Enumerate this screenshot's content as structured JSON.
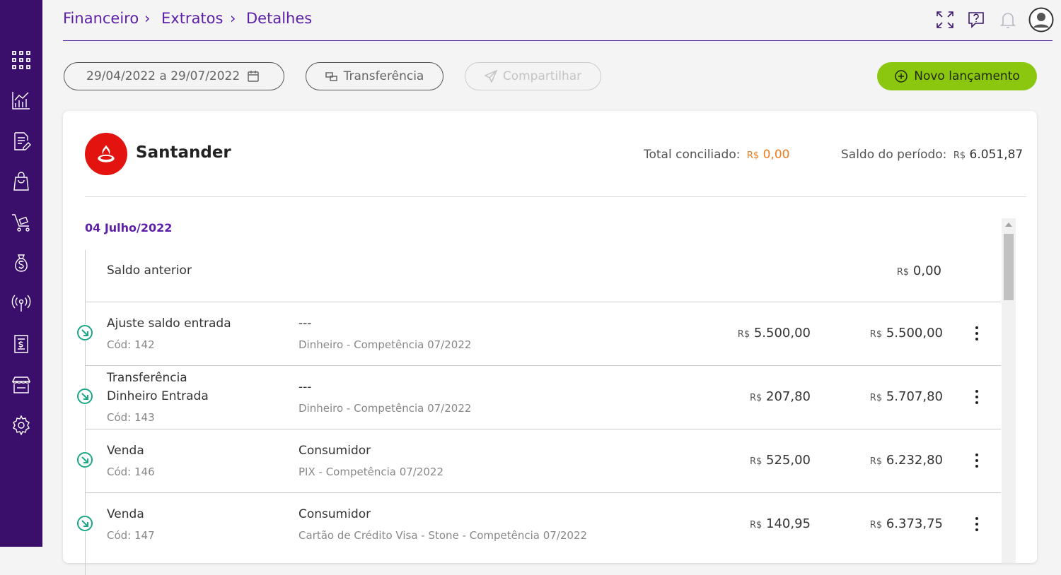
{
  "breadcrumb": [
    "Financeiro",
    "Extratos",
    "Detalhes"
  ],
  "toolbar": {
    "date_range": "29/04/2022 a 29/07/2022",
    "transfer_label": "Transferência",
    "share_label": "Compartilhar",
    "new_entry_label": "Novo lançamento"
  },
  "account": {
    "bank_name": "Santander",
    "conciliated_label": "Total conciliado:",
    "currency": "R$",
    "conciliated_value": "0,00",
    "period_label": "Saldo do período:",
    "period_value": "6.051,87"
  },
  "day": {
    "date": "04 Julho/2022",
    "previous_balance_label": "Saldo anterior",
    "previous_balance_value": "0,00"
  },
  "rows": [
    {
      "title": "Ajuste saldo entrada",
      "title2": "",
      "code": "Cód: 142",
      "party": "---",
      "detail": "Dinheiro - Competência 07/2022",
      "amount": "5.500,00",
      "balance": "5.500,00"
    },
    {
      "title": "Transferência",
      "title2": "Dinheiro Entrada",
      "code": "Cód: 143",
      "party": "---",
      "detail": "Dinheiro - Competência 07/2022",
      "amount": "207,80",
      "balance": "5.707,80"
    },
    {
      "title": "Venda",
      "title2": "",
      "code": "Cód: 146",
      "party": "Consumidor",
      "detail": "PIX - Competência 07/2022",
      "amount": "525,00",
      "balance": "6.232,80"
    },
    {
      "title": "Venda",
      "title2": "",
      "code": "Cód: 147",
      "party": "Consumidor",
      "detail": "Cartão de Crédito Visa - Stone - Competência 07/2022",
      "amount": "140,95",
      "balance": "6.373,75"
    }
  ],
  "colors": {
    "sidebar": "#3a0f6b",
    "accent": "#5b1fa8",
    "primary_button": "#8cc710",
    "income_icon": "#1ba786",
    "conciliated": "#f07c1d",
    "bank_logo": "#e3140f"
  },
  "icons": {
    "sidebar": [
      "apps-grid-icon",
      "chart-icon",
      "document-edit-icon",
      "shopping-bag-icon",
      "cart-icon",
      "money-bag-icon",
      "broadcast-icon",
      "receipt-icon",
      "store-icon",
      "gear-icon"
    ],
    "top": [
      "fullscreen-icon",
      "help-icon",
      "bell-icon",
      "user-avatar-icon"
    ]
  }
}
